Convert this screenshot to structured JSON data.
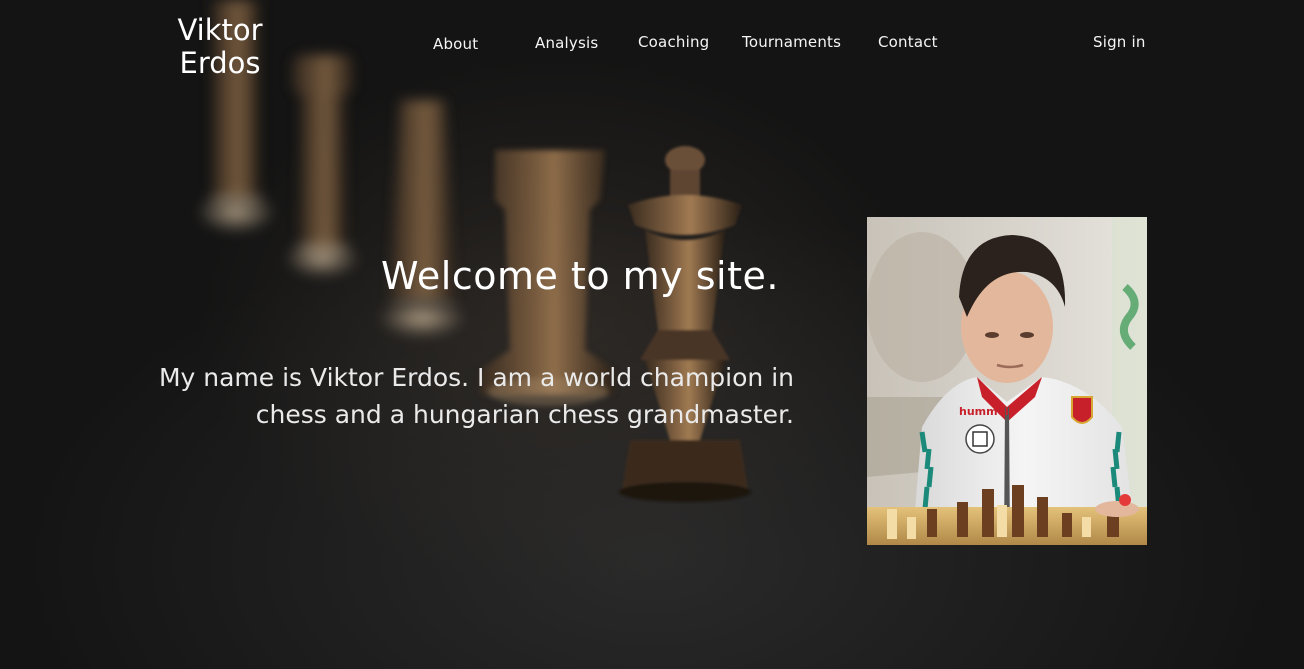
{
  "header": {
    "logo_line1": "Viktor",
    "logo_line2": "Erdos",
    "nav": {
      "about": "About",
      "analysis": "Analysis",
      "coaching": "Coaching",
      "tournaments": "Tournaments",
      "contact": "Contact"
    },
    "sign_in": "Sign in"
  },
  "hero": {
    "title": "Welcome to my site.",
    "intro": "My name is Viktor Erdos. I am a world champion in chess and a hungarian chess grandmaster."
  },
  "portrait": {
    "shirt_brand": "hummel"
  },
  "colors": {
    "background": "#121212",
    "text": "#ffffff",
    "piece_bronze": "#7a5c3e",
    "jacket_white": "#f2f2f2",
    "jacket_trim": "#1b8a7a",
    "collar_red": "#c8202a"
  }
}
